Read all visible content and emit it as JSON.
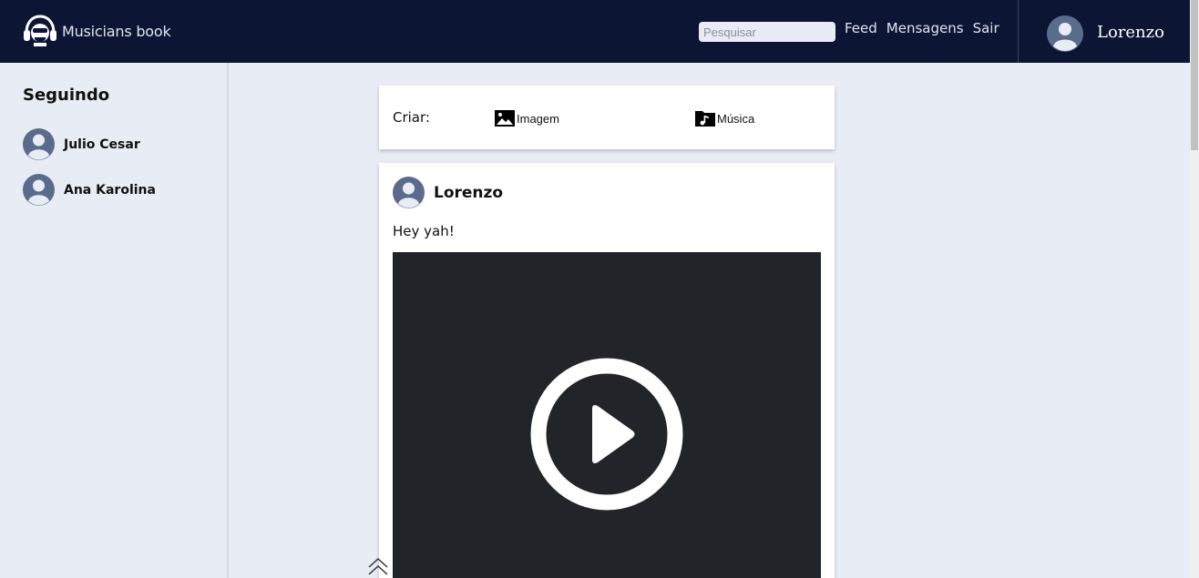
{
  "header": {
    "brand_name": "Musicians book",
    "search_placeholder": "Pesquisar",
    "nav": {
      "feed": "Feed",
      "messages": "Mensagens",
      "logout": "Sair"
    },
    "user_name": "Lorenzo"
  },
  "sidebar": {
    "title": "Seguindo",
    "following": [
      {
        "name": "Julio Cesar"
      },
      {
        "name": "Ana Karolina"
      }
    ]
  },
  "create": {
    "label": "Criar:",
    "image_label": "Imagem",
    "music_label": "Música"
  },
  "post": {
    "author": "Lorenzo",
    "text": "Hey yah!"
  },
  "colors": {
    "header_bg": "#0d1535",
    "page_bg": "#e8ecf4",
    "video_bg": "#212529",
    "avatar": "#5b6b8c"
  },
  "icons": [
    "headphones-logo-icon",
    "avatar-icon",
    "image-icon",
    "music-folder-icon",
    "play-icon",
    "chevron-double-up-icon"
  ]
}
